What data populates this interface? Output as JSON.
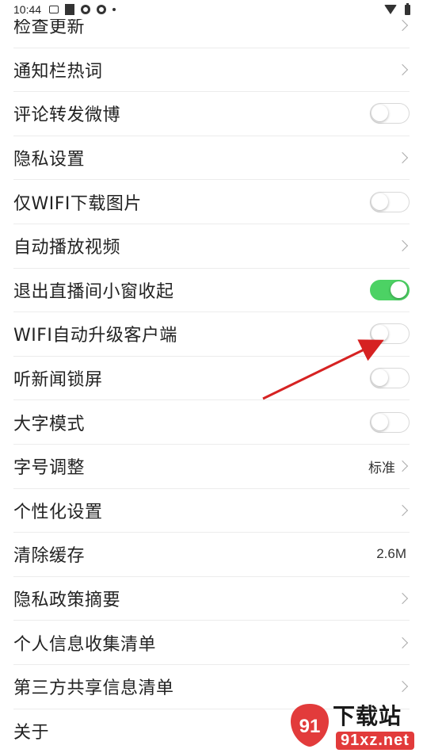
{
  "status_bar": {
    "time": "10:44"
  },
  "settings": [
    {
      "label": "检查更新",
      "control": "chevron"
    },
    {
      "label": "通知栏热词",
      "control": "chevron"
    },
    {
      "label": "评论转发微博",
      "control": "toggle",
      "on": false
    },
    {
      "label": "隐私设置",
      "control": "chevron"
    },
    {
      "label": "仅WIFI下载图片",
      "control": "toggle",
      "on": false
    },
    {
      "label": "自动播放视频",
      "control": "chevron"
    },
    {
      "label": "退出直播间小窗收起",
      "control": "toggle",
      "on": true
    },
    {
      "label": "WIFI自动升级客户端",
      "control": "toggle",
      "on": false
    },
    {
      "label": "听新闻锁屏",
      "control": "toggle",
      "on": false
    },
    {
      "label": "大字模式",
      "control": "toggle",
      "on": false
    },
    {
      "label": "字号调整",
      "control": "chevron",
      "value": "标准"
    },
    {
      "label": "个性化设置",
      "control": "chevron"
    },
    {
      "label": "清除缓存",
      "control": "value",
      "value": "2.6M"
    },
    {
      "label": "隐私政策摘要",
      "control": "chevron"
    },
    {
      "label": "个人信息收集清单",
      "control": "chevron"
    },
    {
      "label": "第三方共享信息清单",
      "control": "chevron"
    },
    {
      "label": "关于",
      "control": "none"
    }
  ],
  "watermark": {
    "brand": "下载站",
    "url": "91xz.net",
    "logo_text": "91"
  },
  "colors": {
    "toggle_on": "#4cd264",
    "arrow": "#d62222",
    "divider": "#ececec"
  }
}
